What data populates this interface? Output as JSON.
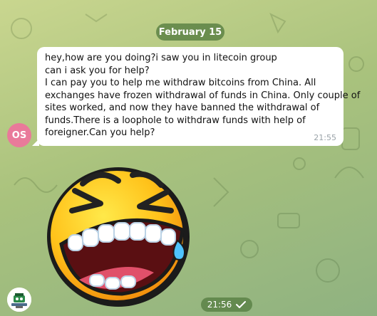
{
  "date_separator": "February 15",
  "incoming": {
    "avatar_initials": "OS",
    "lines": [
      "hey,how are you doing?i saw you in litecoin group",
      "can i ask you for help?",
      "I can pay you to help me withdraw bitcoins from China. All",
      "exchanges have frozen withdrawal of funds in China. Only couple of",
      "sites worked, and now they have banned the withdrawal of",
      "funds.There is a loophole to withdraw funds with help of",
      "foreigner.Can you help?"
    ],
    "time": "21:55"
  },
  "outgoing": {
    "sticker": "laughing-crying-emoji-sticker",
    "time": "21:56",
    "status_icon": "check-icon"
  },
  "colors": {
    "date_pill": "#5a7a3c",
    "incoming_avatar": "#e97a9a",
    "bubble": "#ffffff",
    "chat_background": "#b5c982"
  }
}
